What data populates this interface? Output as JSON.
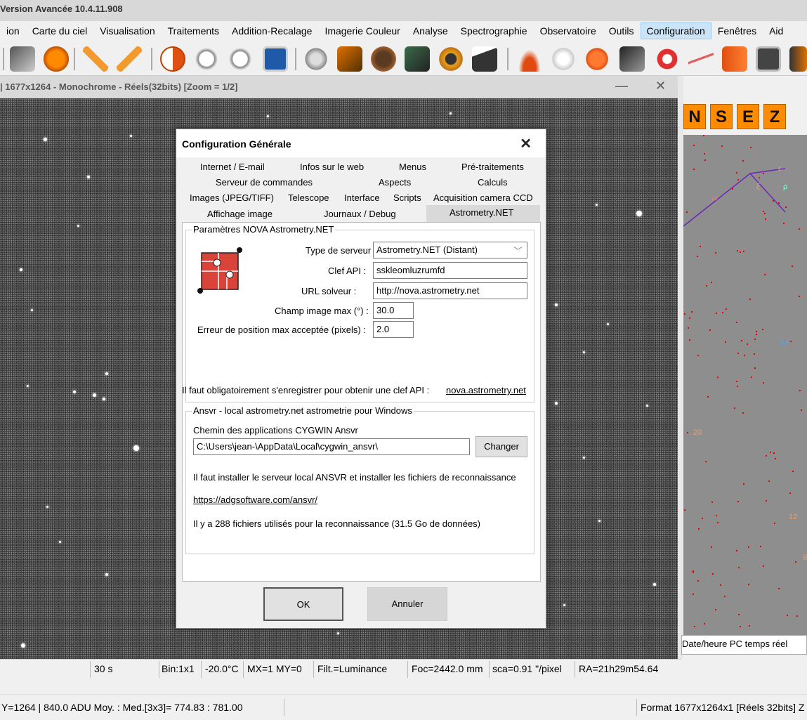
{
  "window": {
    "title": "Version Avancée  10.4.11.908"
  },
  "menu": {
    "items": [
      "ion",
      "Carte du ciel",
      "Visualisation",
      "Traitements",
      "Addition-Recalage",
      "Imagerie Couleur",
      "Analyse",
      "Spectrographie",
      "Observatoire",
      "Outils",
      "Configuration",
      "Fenêtres",
      "Aid"
    ],
    "active": "Configuration"
  },
  "image_window": {
    "title": "| 1677x1264 - Monochrome - Réels(32bits)  [Zoom = 1/2]",
    "minimize": "—",
    "close": "✕"
  },
  "sky_buttons": [
    "N",
    "S",
    "E",
    "Z"
  ],
  "sky_status": "Date/heure PC temps réel",
  "sky_labels": [
    "ε",
    "ξ",
    "ρ",
    "ω",
    "14",
    "20",
    "12",
    "9"
  ],
  "status1": {
    "exposure": "30 s",
    "binning": "Bin:1x1",
    "temperature": "-20.0°C",
    "mirror": "MX=1 MY=0",
    "filter": "Filt.=Luminance",
    "focal": "Foc=2442.0 mm",
    "scale": "sca=0.91 \"/pixel",
    "ra": "RA=21h29m54.64"
  },
  "status2": {
    "pixel": "Y=1264 | 840.0 ADU  Moy. : Med.[3x3]= 774.83 : 781.00",
    "format": "Format 1677x1264x1 [Réels 32bits]  Z"
  },
  "dialog": {
    "title": "Configuration Générale",
    "close": "✕",
    "tabs_row1": [
      "Internet / E-mail",
      "Infos sur le web",
      "Menus",
      "Pré-traitements"
    ],
    "tabs_row2": [
      "Serveur de commandes",
      "Aspects",
      "Calculs"
    ],
    "tabs_row3": [
      "Images (JPEG/TIFF)",
      "Telescope",
      "Interface",
      "Scripts",
      "Acquisition camera CCD"
    ],
    "tabs_row4": [
      "Affichage image",
      "Journaux / Debug",
      "Astrometry.NET"
    ],
    "nova_group": "Paramètres  NOVA Astrometry.NET",
    "server_type_label": "Type de serveur :",
    "server_type_value": "Astrometry.NET (Distant)",
    "api_key_label": "Clef API :",
    "api_key_value": "sskleomluzrumfd",
    "solver_url_label": "URL solveur :",
    "solver_url_value": "http://nova.astrometry.net",
    "max_field_label": "Champ image max (°) :",
    "max_field_value": "30.0",
    "max_error_label": "Erreur de position max acceptée (pixels) :",
    "max_error_value": "2.0",
    "register_text": "Il faut obligatoirement s'enregistrer pour obtenir une clef API :",
    "register_link": "nova.astrometry.net",
    "ansvr_group": "Ansvr - local astrometry.net astrometrie pour Windows",
    "cygwin_label": "Chemin des applications CYGWIN Ansvr",
    "cygwin_path": "C:\\Users\\jean-\\AppData\\Local\\cygwin_ansvr\\",
    "change_button": "Changer",
    "install_text": "Il faut installer le serveur local ANSVR et installer les fichiers de reconnaissance",
    "ansvr_link": "https://adgsoftware.com/ansvr/",
    "files_text": "Il y a 288 fichiers utilisés pour la reconnaissance (31.5 Go de données)",
    "ok": "OK",
    "cancel": "Annuler"
  },
  "colors": {
    "accent_menu": "#cce4f7",
    "sky_button": "#ff8c00",
    "sky_background": "#8e8e8e",
    "logo_red": "#d9433a"
  }
}
